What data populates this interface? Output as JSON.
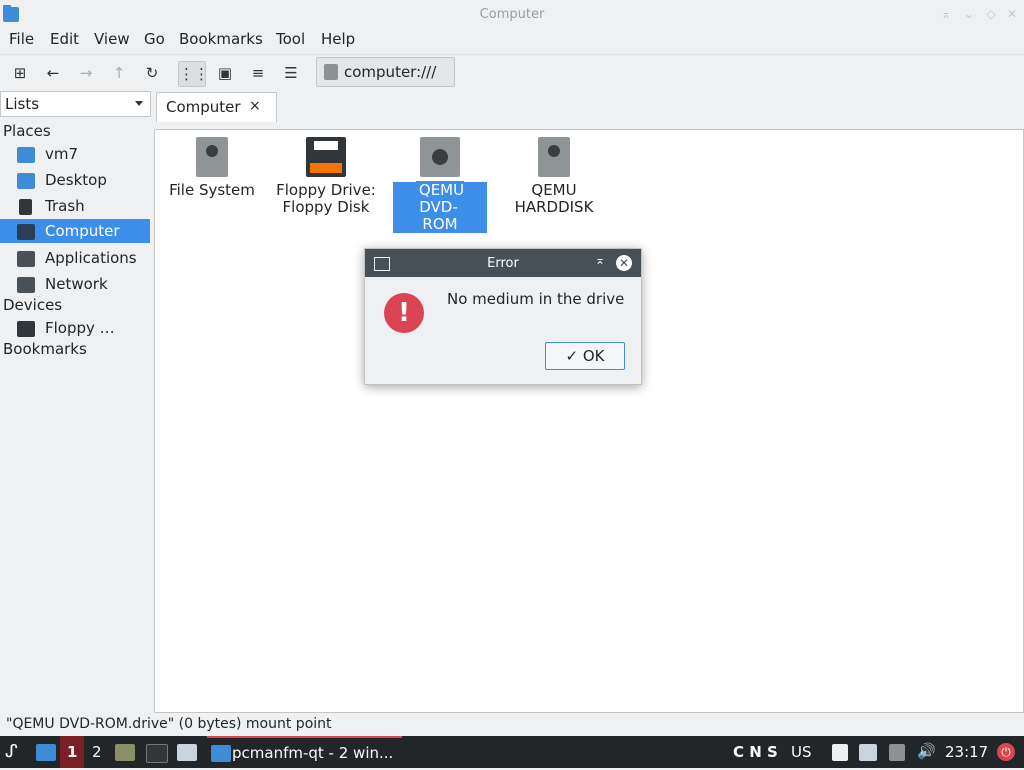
{
  "window": {
    "title": "Computer"
  },
  "menu": [
    "File",
    "Edit",
    "View",
    "Go",
    "Bookmarks",
    "Tool",
    "Help"
  ],
  "toolbar": {
    "address": "computer:///"
  },
  "sidebar": {
    "selector": "Lists",
    "sections": {
      "places": "Places",
      "devices": "Devices",
      "bookmarks": "Bookmarks"
    },
    "places": [
      {
        "label": "vm7",
        "icon": "home-folder-icon"
      },
      {
        "label": "Desktop",
        "icon": "desktop-icon"
      },
      {
        "label": "Trash",
        "icon": "trash-icon"
      },
      {
        "label": "Computer",
        "icon": "computer-icon",
        "selected": true
      },
      {
        "label": "Applications",
        "icon": "applications-icon"
      },
      {
        "label": "Network",
        "icon": "network-icon"
      }
    ],
    "devices": [
      {
        "label": "Floppy …",
        "icon": "floppy-icon"
      }
    ]
  },
  "tabs": [
    {
      "label": "Computer",
      "close": "×"
    }
  ],
  "files": [
    {
      "label1": "File System",
      "label2": "",
      "icon": "drive-icon"
    },
    {
      "label1": "Floppy Drive:",
      "label2": "Floppy Disk",
      "icon": "floppy-drive-icon"
    },
    {
      "label1": "QEMU DVD-",
      "label2": "ROM",
      "icon": "dvd-icon",
      "selected": true
    },
    {
      "label1": "QEMU",
      "label2": "HARDDISK",
      "icon": "harddisk-icon"
    }
  ],
  "status": "\"QEMU DVD-ROM.drive\" (0 bytes) mount point",
  "dialog": {
    "title": "Error",
    "message": "No medium in the drive",
    "ok": "OK",
    "ok_check": "✓"
  },
  "taskbar": {
    "workspaces": [
      "1",
      "2"
    ],
    "window_label": "pcmanfm-qt - 2 win...",
    "indicators": "C N S",
    "layout": "US",
    "clock": "23:17"
  },
  "colors": {
    "accent": "#3d8ee9",
    "error": "#da4453",
    "taskbar": "#232629"
  }
}
